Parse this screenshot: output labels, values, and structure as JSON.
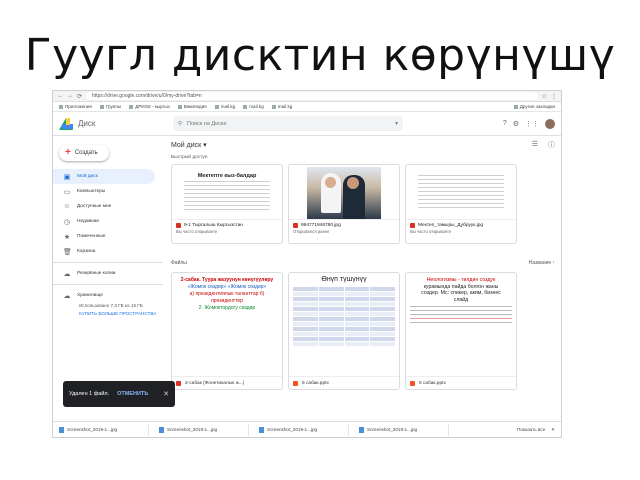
{
  "slide_title": "Гуугл дисктин көрүнүшү",
  "browser": {
    "nav_icons": [
      "back-icon",
      "forward-icon",
      "reload-icon"
    ],
    "url": "https://drive.google.com/drive/u/0/my-drive?tab=n",
    "bookmarks": [
      "Приложения",
      "Группы",
      "ДРИЭЗ - кыргыз",
      "Википедия",
      "mail.kg",
      "mail.kg",
      "mail.kg",
      "Другие закладки"
    ]
  },
  "drive": {
    "name": "Диск",
    "search_placeholder": "Поиск на Диске",
    "new_button": "Создать",
    "breadcrumb": "Мой диск",
    "quick_access_label": "Быстрый доступ",
    "files_label": "Файлы",
    "sort_label": "Название",
    "sidebar": [
      {
        "label": "Мой диск",
        "icon": "drive-icon",
        "active": true
      },
      {
        "label": "Компьютеры",
        "icon": "computer-icon",
        "active": false
      },
      {
        "label": "Доступные мне",
        "icon": "shared-icon",
        "active": false
      },
      {
        "label": "Недавние",
        "icon": "clock-icon",
        "active": false
      },
      {
        "label": "Помеченные",
        "icon": "star-icon",
        "active": false
      },
      {
        "label": "Корзина",
        "icon": "trash-icon",
        "active": false
      }
    ],
    "backups": "Резервные копии",
    "storage": {
      "title": "Хранилище",
      "usage": "Использовано 7,3 ГБ из 15 ГБ",
      "upgrade": "КУПИТЬ БОЛЬШЕ ПРОСТРАНСТВА"
    },
    "quick_access": [
      {
        "title": "Мектепте кыз-балдар",
        "name": "9-1 Тыргалыш Кыргызстан",
        "sub": "Вы часто открываете"
      },
      {
        "title": "",
        "name": "994771946780.jpg",
        "sub": "Открывался ранее"
      },
      {
        "title": "",
        "name": "Мектеп_тамыры_Дубруук.jpg",
        "sub": "Вы часто открываете"
      }
    ],
    "files": [
      {
        "name": "2-сабак (Фонетикалык ж...)",
        "lines": [
          "2-сабак. Туура жазуунун көнүгүүлөрү",
          "«Жомок сөздөр» «Жомок сөздөр»",
          "а) презедентиялык таланттар б) президенттер",
          "2. Жомоктордогу сөздөр"
        ]
      },
      {
        "name": "5 сабак.pptx",
        "title": "Өнүп түшүнүү"
      },
      {
        "name": "5 сабак.pptx",
        "lines": [
          "Неологизмы - тилдин создук",
          "курамында пайда болгон жаны",
          "создер. Мс: спикер, аким, бизнес",
          "слайд"
        ]
      }
    ],
    "toast": {
      "message": "Удален 1 файл.",
      "undo": "ОТМЕНИТЬ"
    },
    "downloads": [
      "Screenshot_2019-1...jpg",
      "Screenshot_2019-1...jpg",
      "Screenshot_2019-1...jpg",
      "Screenshot_2019-1...jpg"
    ],
    "show_all": "Показать все"
  }
}
